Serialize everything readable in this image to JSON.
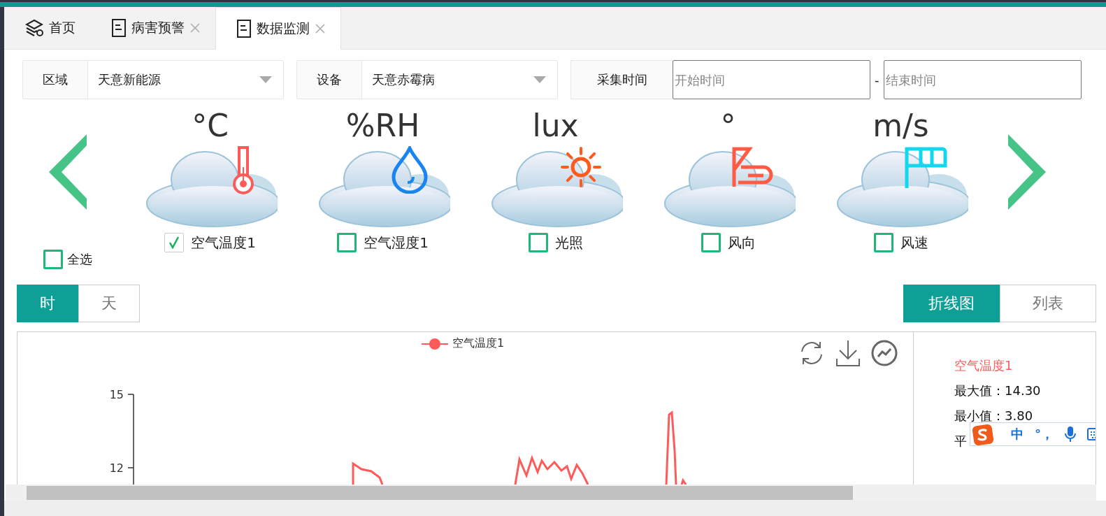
{
  "tabs": [
    {
      "label": "首页",
      "kind": "home",
      "selected": false,
      "closable": false
    },
    {
      "label": "病害预警",
      "kind": "page",
      "selected": false,
      "closable": true
    },
    {
      "label": "数据监测",
      "kind": "page",
      "selected": true,
      "closable": true
    }
  ],
  "filters": [
    {
      "label": "区域",
      "value": "天意新能源"
    },
    {
      "label": "设备",
      "value": "天意赤霉病"
    }
  ],
  "time_range": {
    "label": "采集时间",
    "start_placeholder": "开始时间",
    "separator": "-",
    "end_placeholder": "结束时间"
  },
  "select_all": {
    "label": "全选",
    "checked": false
  },
  "sensors": [
    {
      "unit": "°C",
      "label": "空气温度1",
      "kind": "temperature",
      "checked": true
    },
    {
      "unit": "%RH",
      "label": "空气湿度1",
      "kind": "humidity",
      "checked": false
    },
    {
      "unit": "lux",
      "label": "光照",
      "kind": "light",
      "checked": false
    },
    {
      "unit": "°",
      "label": "风向",
      "kind": "wind_direction",
      "checked": false
    },
    {
      "unit": "m/s",
      "label": "风速",
      "kind": "wind_speed",
      "checked": false
    }
  ],
  "period_tabs": [
    {
      "label": "时",
      "selected": true
    },
    {
      "label": "天",
      "selected": false
    }
  ],
  "view_tabs": [
    {
      "label": "折线图",
      "selected": true
    },
    {
      "label": "列表",
      "selected": false
    }
  ],
  "chart": {
    "legend": "空气温度1",
    "y_ticks": [
      "15",
      "12"
    ]
  },
  "stats": {
    "title": "空气温度1",
    "rows": [
      {
        "label": "最大值：",
        "value": "14.30"
      },
      {
        "label": "最小值：",
        "value": "3.80"
      },
      {
        "label": "平"
      }
    ]
  },
  "ime_bar": {
    "items": [
      "中",
      "°，"
    ]
  }
}
